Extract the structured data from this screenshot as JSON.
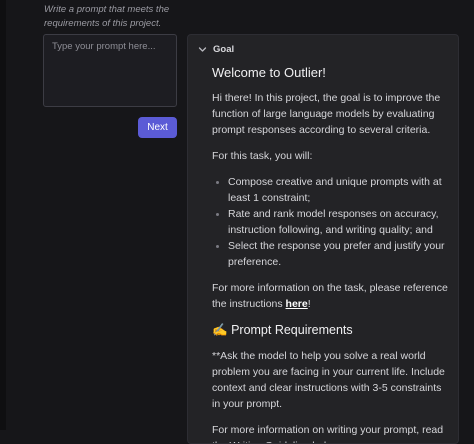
{
  "prompt": {
    "instruction": "Write a prompt that meets the requirements of this project.",
    "placeholder": "Type your prompt here...",
    "next_label": "Next"
  },
  "goal": {
    "header": "Goal",
    "welcome_title": "Welcome to Outlier!",
    "intro": "Hi there! In this project, the goal is to improve the function of large language models by evaluating prompt responses according to several criteria.",
    "task_intro": "For this task, you will:",
    "tasks": [
      "Compose creative and unique prompts with at least 1 constraint;",
      "Rate and rank model responses on accuracy, instruction following, and writing quality; and",
      "Select the response you prefer and justify your preference."
    ],
    "more_info_prefix": "For more information on the task, please reference the instructions ",
    "more_info_link": "here",
    "more_info_suffix": "!",
    "req_emoji": "✍️",
    "req_title": "Prompt Requirements",
    "req_body": "**Ask the model to help you solve a real world problem you are facing in your current life. Include context and clear instructions with 3-5 constraints in your prompt.",
    "writing_info": "For more information on writing your prompt, read the Writing Guideline below."
  }
}
